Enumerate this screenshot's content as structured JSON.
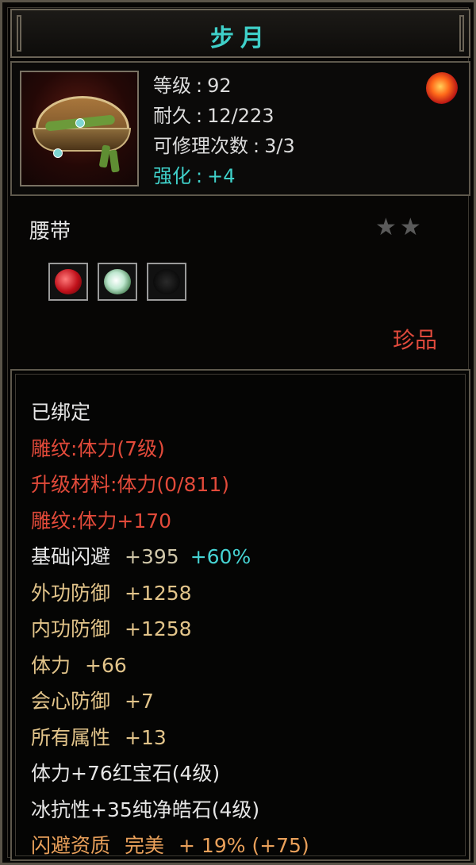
{
  "item": {
    "name": "步月",
    "level_label": "等级",
    "level_value": "92",
    "durability_label": "耐久",
    "durability_value": "12/223",
    "repair_label": "可修理次数",
    "repair_value": "3/3",
    "enhance_label": "强化",
    "enhance_value": "+4",
    "type": "腰带",
    "stars": "★★",
    "rarity": "珍品"
  },
  "details": {
    "bound": "已绑定",
    "engrave": "雕纹:体力(7级)",
    "upgrade_material": "升级材料:体力(0/811)",
    "engrave_bonus": "雕纹:体力+170",
    "dodge_label": "基础闪避",
    "dodge_value": "+395",
    "dodge_pct": "+60%",
    "outer_def_label": "外功防御",
    "outer_def_value": "+1258",
    "inner_def_label": "内功防御",
    "inner_def_value": "+1258",
    "stamina_label": "体力",
    "stamina_value": "+66",
    "crit_def_label": "会心防御",
    "crit_def_value": "+7",
    "all_attr_label": "所有属性",
    "all_attr_value": "+13",
    "gem1": "体力+76红宝石(4级)",
    "gem2": "冰抗性+35纯净皓石(4级)",
    "quality_label": "闪避资质",
    "quality_grade": "完美",
    "quality_value": "+ 19% (+75)"
  },
  "colors": {
    "title": "#3fd0c9",
    "red_text": "#e24a3a",
    "gold_text": "#e2c48a",
    "cyan_text": "#46d4d4",
    "orange_text": "#e9a05a"
  },
  "icons": {
    "item": "belt-icon",
    "badge": "fire-emblem-icon",
    "socket1": "ruby-gem-icon",
    "socket2": "white-gem-icon",
    "socket3": "empty-socket-icon"
  }
}
